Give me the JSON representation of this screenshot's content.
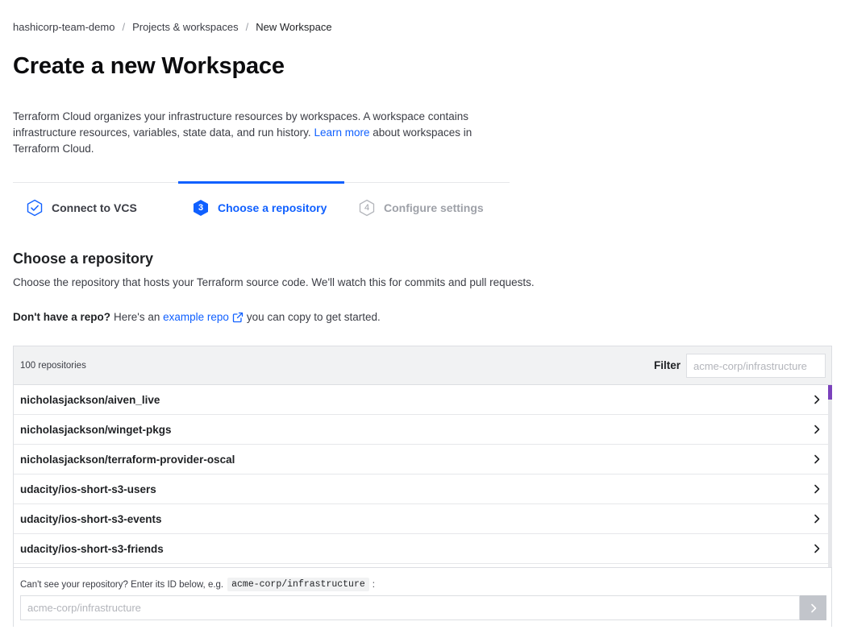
{
  "breadcrumb": {
    "org": "hashicorp-team-demo",
    "separator": "/",
    "projects": "Projects & workspaces",
    "current": "New Workspace"
  },
  "page": {
    "title": "Create a new Workspace",
    "intro_before": "Terraform Cloud organizes your infrastructure resources by workspaces. A workspace contains infrastructure resources, variables, state data, and run history. ",
    "intro_link": "Learn more",
    "intro_after": " about workspaces in Terraform Cloud."
  },
  "steps": [
    {
      "label": "Connect to VCS",
      "state": "complete",
      "icon": "check-hexagon-icon"
    },
    {
      "number": "3",
      "label": "Choose a repository",
      "state": "active"
    },
    {
      "number": "4",
      "label": "Configure settings",
      "state": "upcoming"
    }
  ],
  "section": {
    "title": "Choose a repository",
    "description": "Choose the repository that hosts your Terraform source code. We'll watch this for commits and pull requests.",
    "norepo_bold": "Don't have a repo?",
    "norepo_text": "Here's an",
    "norepo_link": "example repo",
    "norepo_after": "you can copy to get started."
  },
  "repo_panel": {
    "count": "100 repositories",
    "filter_label": "Filter",
    "filter_placeholder": "acme-corp/infrastructure",
    "repositories": [
      "nicholasjackson/aiven_live",
      "nicholasjackson/winget-pkgs",
      "nicholasjackson/terraform-provider-oscal",
      "udacity/ios-short-s3-users",
      "udacity/ios-short-s3-events",
      "udacity/ios-short-s3-friends"
    ],
    "manual_label": "Can't see your repository? Enter its ID below, e.g.",
    "manual_example": "acme-corp/infrastructure",
    "manual_colon": ":",
    "manual_placeholder": "acme-corp/infrastructure"
  },
  "colors": {
    "accent": "#1060ff",
    "scroll_thumb": "#7b42bc",
    "muted": "#9ea1a8"
  }
}
